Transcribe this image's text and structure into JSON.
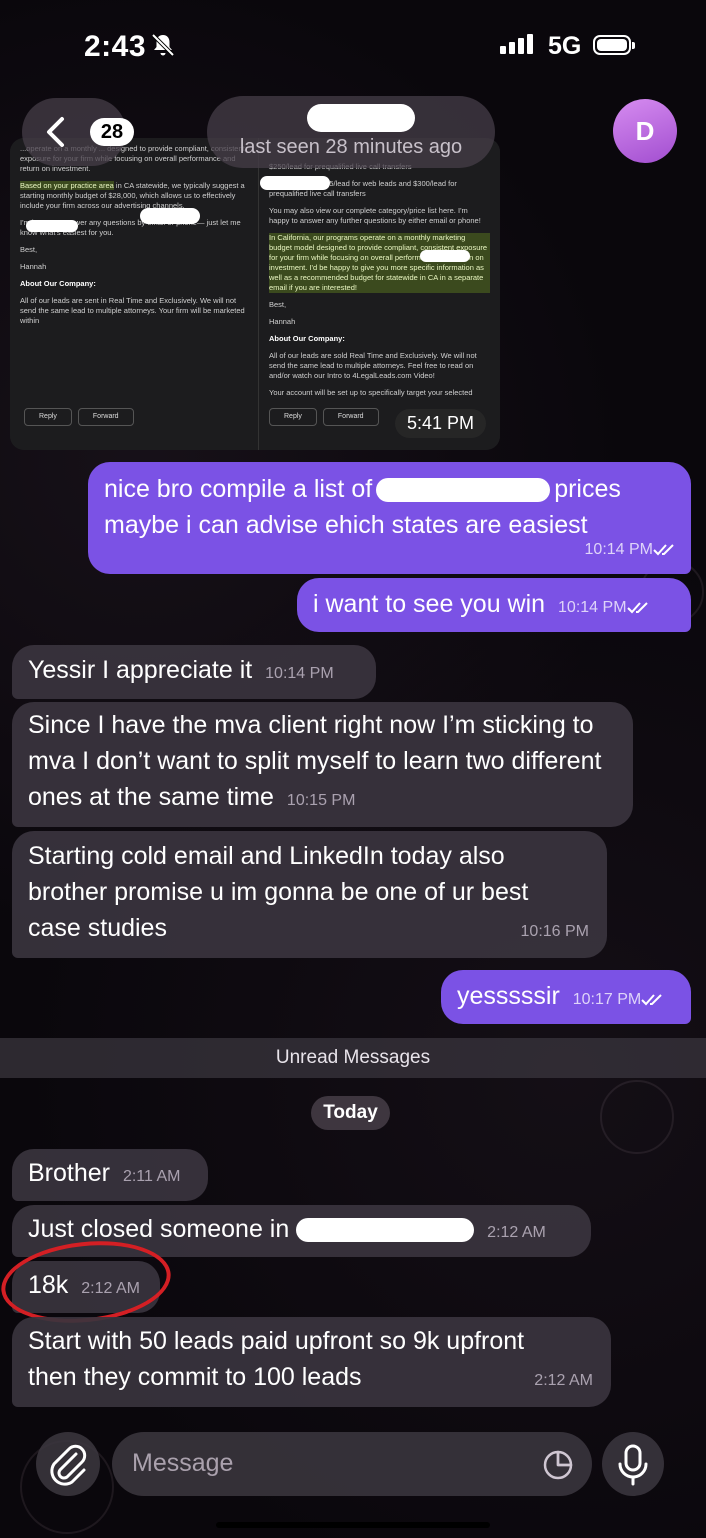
{
  "status_bar": {
    "time": "2:43",
    "network": "5G"
  },
  "header": {
    "back_count": "28",
    "last_seen": "last seen 28 minutes ago",
    "avatar_letter": "D"
  },
  "image_message": {
    "time": "5:41 PM",
    "left_pane": {
      "p1": "...operate on a monthly ... designed to provide compliant, consistent exposure for your firm while focusing on overall performance and return on investment.",
      "p2a": "Based on your practice area",
      "p2b": "in CA statewide, we typically suggest a starting monthly budget of $28,000, which allows us to effectively include your firm across our advertising channels.",
      "p3": "I'm happy to answer any questions by email or phone— just let me know what's easiest for you.",
      "p4": "Best,",
      "p5": "Hannah",
      "p6": "About Our Company:",
      "p7": "All of our leads are sent in Real Time and Exclusively. We will not send the same lead to multiple attorneys. Your firm will be marketed within",
      "reply": "Reply",
      "forward": "Forward"
    },
    "right_pane": {
      "p1": "$250/lead for prequalified live call transfers",
      "p2": "leads in TX at $225/lead for web leads and $300/lead for prequalified live call transfers",
      "p3": "You may also view our complete category/price list here. I'm happy to answer any further questions by either email or phone!",
      "p4": "In California, our programs operate on a monthly marketing budget model designed to provide compliant, consistent exposure for your firm while focusing on overall performance and return on investment. I'd be happy to give you more specific information as well as a recommended budget for statewide in CA in a separate email if you are interested!",
      "p5": "Best,",
      "p6": "Hannah",
      "p7": "About Our Company:",
      "p8": "All of our leads are sold Real Time and Exclusively. We will not send the same lead to multiple attorneys. Feel free to read on and/or watch our Intro to 4LegalLeads.com Video!",
      "p9": "Your account will be set up to specifically target your selected",
      "reply": "Reply",
      "forward": "Forward"
    }
  },
  "messages": [
    {
      "dir": "out",
      "line1a": "nice bro compile a list of",
      "line1b": "prices",
      "line2": "maybe i can advise ehich states are easiest",
      "time": "10:14 PM"
    },
    {
      "dir": "out",
      "text": "i want to see you win",
      "time": "10:14 PM"
    },
    {
      "dir": "in",
      "text": "Yessir I appreciate it",
      "time": "10:14 PM"
    },
    {
      "dir": "in",
      "text": "Since I have the mva client right now I’m sticking to mva I don’t want to split myself to learn two different ones at the same time",
      "time": "10:15 PM"
    },
    {
      "dir": "in",
      "text": "Starting cold email and LinkedIn today also brother promise u im gonna be one of ur best case studies",
      "time": "10:16 PM"
    },
    {
      "dir": "out",
      "text": "yesssssir",
      "time": "10:17 PM"
    },
    {
      "dir": "in",
      "text": "Brother",
      "time": "2:11 AM"
    },
    {
      "dir": "in",
      "text": "Just closed someone in",
      "time": "2:12 AM"
    },
    {
      "dir": "in",
      "text": "18k",
      "time": "2:12 AM"
    },
    {
      "dir": "in",
      "text": "Start with 50 leads paid upfront so 9k upfront then they commit to 100 leads",
      "time": "2:12 AM"
    }
  ],
  "unread_divider": "Unread Messages",
  "date_chip": "Today",
  "composer": {
    "placeholder": "Message"
  },
  "colors": {
    "outgoing": "#7b52e5",
    "incoming": "#3a343e",
    "annotation_circle": "#d41f24",
    "avatar": "#b865e0"
  }
}
